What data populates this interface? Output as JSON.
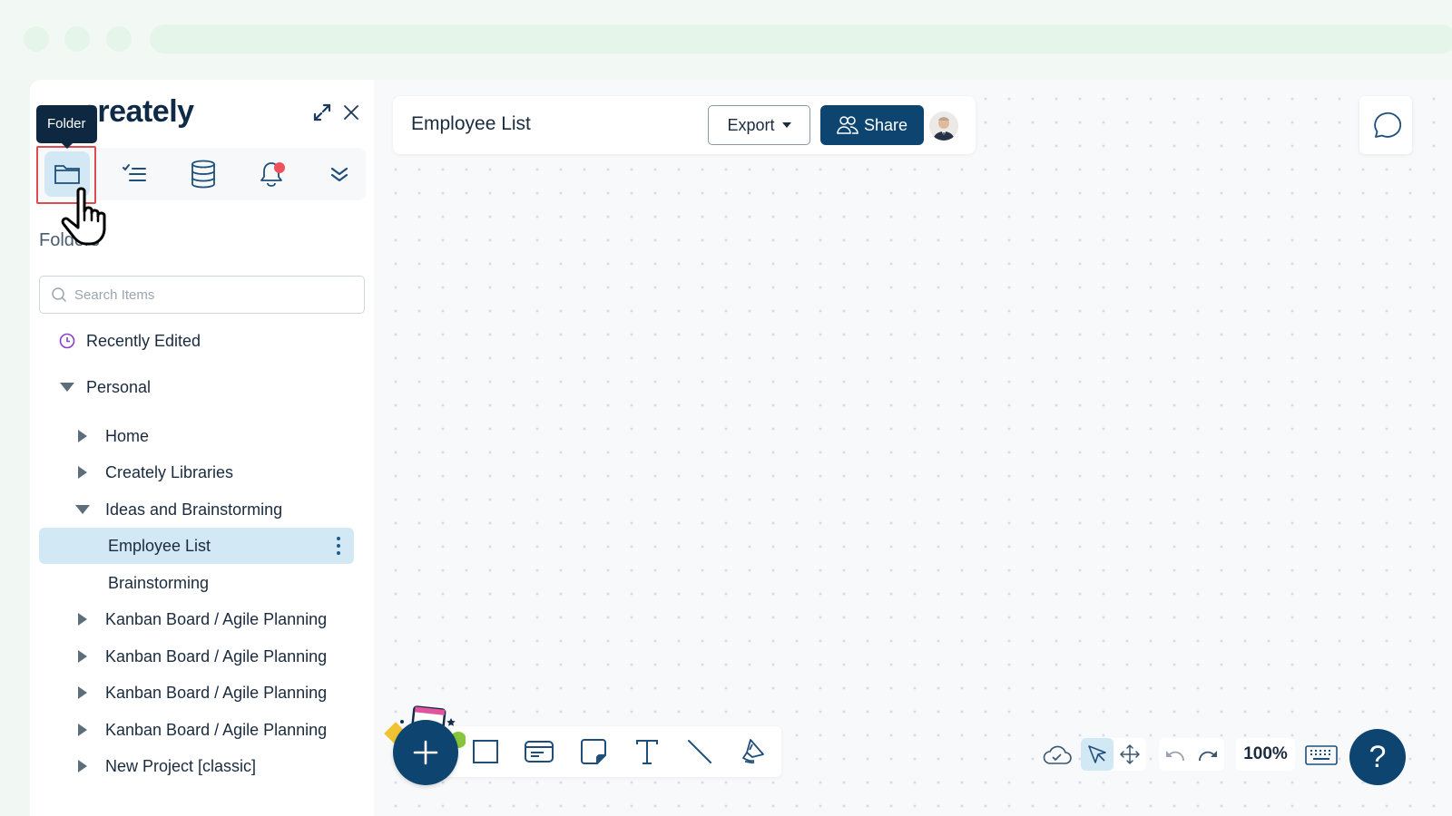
{
  "app": {
    "brand": "creately"
  },
  "sidebar": {
    "tooltip": "Folder",
    "tabs": [
      {
        "name": "folder",
        "active": true
      },
      {
        "name": "tasks",
        "active": false
      },
      {
        "name": "database",
        "active": false
      },
      {
        "name": "notifications",
        "active": false,
        "has_badge": true
      },
      {
        "name": "more",
        "active": false
      }
    ],
    "section_title": "Folders",
    "search": {
      "placeholder": "Search Items",
      "value": ""
    },
    "tree": [
      {
        "label": "Recently Edited",
        "type": "recent"
      },
      {
        "label": "Personal",
        "type": "folder",
        "expanded": true,
        "level": 0
      },
      {
        "label": "Home",
        "type": "folder",
        "expanded": false,
        "level": 1
      },
      {
        "label": "Creately Libraries",
        "type": "folder",
        "expanded": false,
        "level": 1
      },
      {
        "label": "Ideas and Brainstorming",
        "type": "folder",
        "expanded": true,
        "level": 1
      },
      {
        "label": "Employee List",
        "type": "doc",
        "selected": true,
        "level": 2
      },
      {
        "label": "Brainstorming",
        "type": "doc",
        "level": 2
      },
      {
        "label": "Kanban Board / Agile Planning",
        "type": "folder",
        "expanded": false,
        "level": 1
      },
      {
        "label": "Kanban Board / Agile Planning",
        "type": "folder",
        "expanded": false,
        "level": 1
      },
      {
        "label": "Kanban Board / Agile Planning",
        "type": "folder",
        "expanded": false,
        "level": 1
      },
      {
        "label": "Kanban Board / Agile Planning",
        "type": "folder",
        "expanded": false,
        "level": 1
      },
      {
        "label": "New Project [classic]",
        "type": "folder",
        "expanded": false,
        "level": 1
      }
    ]
  },
  "docbar": {
    "title": "Employee List",
    "export_label": "Export",
    "share_label": "Share"
  },
  "toolbar": {
    "tools": [
      "rectangle",
      "card",
      "sticky-note",
      "text",
      "line",
      "pen"
    ],
    "zoom_level": "100%",
    "help_label": "?"
  },
  "colors": {
    "primary": "#0d4470",
    "selected_bg": "#d3e8f5",
    "focus_ring": "#e04a55",
    "badge": "#f0525d"
  }
}
